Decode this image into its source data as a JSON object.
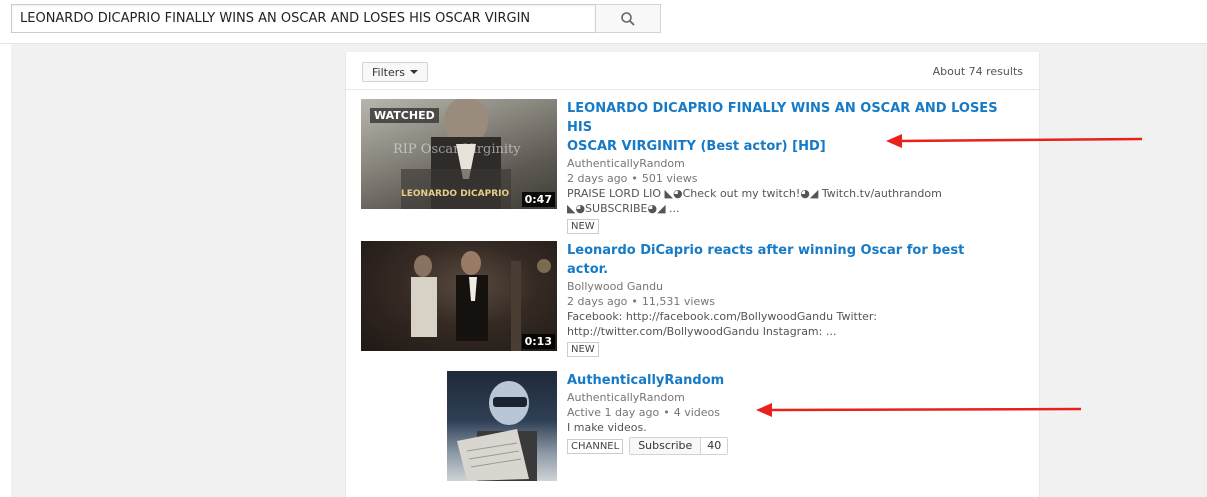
{
  "search": {
    "query": "LEONARDO DICAPRIO FINALLY WINS AN OSCAR AND LOSES HIS OSCAR VIRGIN",
    "search_icon": "search-icon"
  },
  "filters": {
    "label": "Filters",
    "results": "About 74 results"
  },
  "results": [
    {
      "title_line1": "LEONARDO DICAPRIO FINALLY WINS AN OSCAR AND LOSES HIS",
      "title_line2": "OSCAR VIRGINITY (Best actor) [HD]",
      "channel": "AuthenticallyRandom",
      "age": "2 days ago",
      "views": "501 views",
      "desc_line1": "PRAISE LORD LIO ◣◕Check out my twitch!◕◢ Twitch.tv/authrandom",
      "desc_line2": "◣◕SUBSCRIBE◕◢ ...",
      "badge": "NEW",
      "watched": "WATCHED",
      "duration": "0:47",
      "thumb_text1": "RIP Oscar Virginity",
      "thumb_text2": "LEONARDO DICAPRIO"
    },
    {
      "title": "Leonardo DiCaprio reacts after winning Oscar for best actor.",
      "channel": "Bollywood Gandu",
      "age": "2 days ago",
      "views": "11,531 views",
      "desc_line1": "Facebook: http://facebook.com/BollywoodGandu Twitter:",
      "desc_line2": "http://twitter.com/BollywoodGandu Instagram: ...",
      "badge": "NEW",
      "duration": "0:13"
    },
    {
      "title": "AuthenticallyRandom",
      "channel": "AuthenticallyRandom",
      "active": "Active 1 day ago",
      "videos": "4 videos",
      "desc": "I make videos.",
      "badge": "CHANNEL",
      "subscribe_label": "Subscribe",
      "subscriber_count": "40"
    }
  ],
  "colors": {
    "link": "#167ac6",
    "annotation_arrow": "#e8211c"
  }
}
